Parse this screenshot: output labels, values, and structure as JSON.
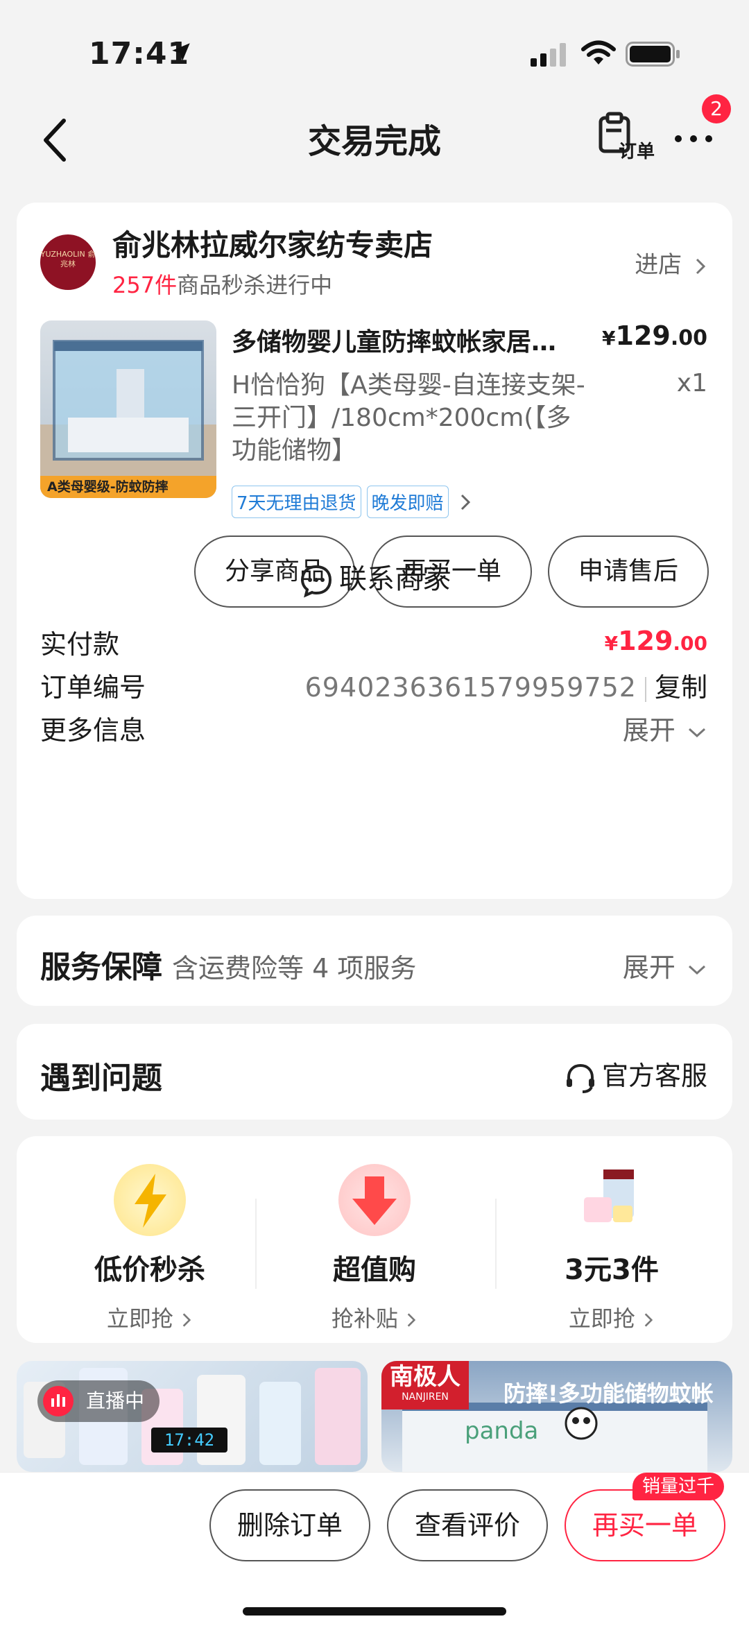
{
  "status_bar": {
    "time": "17:41"
  },
  "nav": {
    "title": "交易完成",
    "order_label": "订单",
    "badge_count": "2"
  },
  "store": {
    "logo_text": "YUZHAOLIN 俞兆林",
    "name": "俞兆林拉威尔家纺专卖店",
    "flash_count": "257件",
    "flash_text": "商品秒杀进行中",
    "enter_label": "进店"
  },
  "product": {
    "name": "多储物婴儿童防摔蚊帐家居蚊帐",
    "spec": "H恰恰狗【A类母婴-自连接支架-三开门】/180cm*200cm(【多功能储物】",
    "image_caption": "A类母婴级-防蚊防摔",
    "price_currency": "¥",
    "price_int": "129",
    "price_dec": ".00",
    "quantity": "x1",
    "tags": [
      "7天无理由退货",
      "晚发即赔"
    ]
  },
  "actions": {
    "share": "分享商品",
    "rebuy": "再买一单",
    "after_sales": "申请售后"
  },
  "order_info": {
    "paid_label": "实付款",
    "paid_currency": "¥",
    "paid_int": "129",
    "paid_dec": ".00",
    "order_no_label": "订单编号",
    "order_no": "6940236361579959752",
    "copy_label": "复制",
    "more_label": "更多信息",
    "expand_label": "展开",
    "contact_label": "联系商家"
  },
  "service": {
    "title": "服务保障",
    "subtitle": "含运费险等 4 项服务",
    "expand_label": "展开"
  },
  "problem": {
    "title": "遇到问题",
    "support_label": "官方客服"
  },
  "promos": [
    {
      "title": "低价秒杀",
      "sub": "立即抢"
    },
    {
      "title": "超值购",
      "sub": "抢补贴"
    },
    {
      "title": "3元3件",
      "sub": "立即抢"
    }
  ],
  "feed": {
    "live_label": "直播中",
    "clock_text": "17:42",
    "brand_name": "南极人",
    "brand_sub": "NANJIREN",
    "banner_text": "防摔!多功能储物蚊帐"
  },
  "bottom": {
    "delete": "删除订单",
    "review": "查看评价",
    "rebuy": "再买一单",
    "sales_badge": "销量过千"
  },
  "colors": {
    "accent": "#ff2442",
    "tag_blue": "#1f7bd6"
  }
}
